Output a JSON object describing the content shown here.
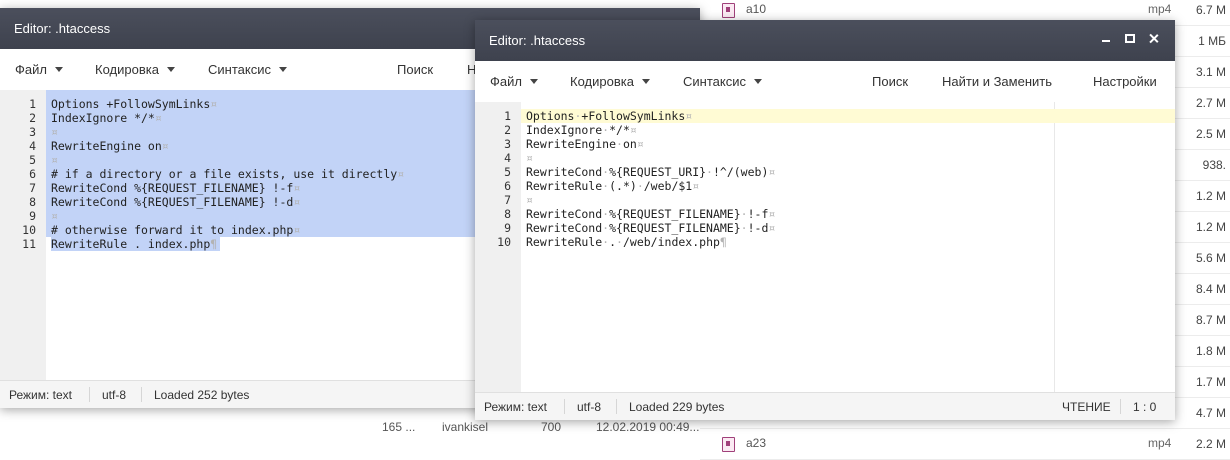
{
  "background_list": {
    "rows": [
      {
        "name": "a10",
        "type": "mp4",
        "size": "6.7 M"
      },
      {
        "name": "",
        "type": "",
        "size": "1 МБ"
      },
      {
        "name": "",
        "type": "",
        "size": "3.1 M"
      },
      {
        "name": "",
        "type": "",
        "size": "2.7 M"
      },
      {
        "name": "",
        "type": "",
        "size": "2.5 M"
      },
      {
        "name": "",
        "type": "",
        "size": "938."
      },
      {
        "name": "",
        "type": "",
        "size": "1.2 M"
      },
      {
        "name": "",
        "type": "",
        "size": "1.2 M"
      },
      {
        "name": "",
        "type": "",
        "size": "5.6 M"
      },
      {
        "name": "",
        "type": "",
        "size": "8.4 M"
      },
      {
        "name": "",
        "type": "",
        "size": "8.7 M"
      },
      {
        "name": "",
        "type": "",
        "size": "1.8 M"
      },
      {
        "name": "",
        "type": "",
        "size": "1.7 M"
      },
      {
        "name": "",
        "type": "",
        "size": "4.7 M"
      },
      {
        "name": "a23",
        "type": "mp4",
        "size": "2.2 M"
      }
    ],
    "footer_row": {
      "size": "165 ...",
      "owner": "ivankisel",
      "perms": "700",
      "date": "12.02.2019 00:49..."
    }
  },
  "editor_back": {
    "title": "Editor: .htaccess",
    "menu": {
      "file": "Файл",
      "encoding": "Кодировка",
      "syntax": "Синтаксис",
      "search": "Поиск",
      "find_replace_partial": "Н"
    },
    "lines": [
      "Options +FollowSymLinks",
      "IndexIgnore */*",
      "",
      "RewriteEngine on",
      "",
      "# if a directory or a file exists, use it directly",
      "RewriteCond %{REQUEST_FILENAME} !-f",
      "RewriteCond %{REQUEST_FILENAME} !-d",
      "",
      "# otherwise forward it to index.php",
      "RewriteRule . index.php"
    ],
    "status": {
      "mode": "Режим: text",
      "encoding": "utf-8",
      "loaded": "Loaded 252 bytes"
    }
  },
  "editor_front": {
    "title": "Editor: .htaccess",
    "menu": {
      "file": "Файл",
      "encoding": "Кодировка",
      "syntax": "Синтаксис",
      "search": "Поиск",
      "find_replace": "Найти и Заменить",
      "settings": "Настройки"
    },
    "lines": [
      "Options +FollowSymLinks",
      "IndexIgnore */*",
      "RewriteEngine on",
      "",
      "RewriteCond %{REQUEST_URI} !^/(web)",
      "RewriteRule (.*) /web/$1",
      "",
      "RewriteCond %{REQUEST_FILENAME} !-f",
      "RewriteCond %{REQUEST_FILENAME} !-d",
      "RewriteRule . /web/index.php"
    ],
    "status": {
      "mode": "Режим: text",
      "encoding": "utf-8",
      "loaded": "Loaded 229 bytes",
      "readonly": "ЧТЕНИЕ",
      "cursor": "1 : 0"
    }
  },
  "icons": {
    "file_icon": "video-file-icon",
    "window_controls": [
      "minimize-icon",
      "maximize-icon",
      "close-icon"
    ],
    "whitespace_marker": "¤",
    "eof_marker": "¶"
  },
  "colors": {
    "titlebar": "#44485a",
    "selection": "#c2d3f7",
    "active_line": "#fffbd4",
    "gutter": "#f0f0f0"
  }
}
